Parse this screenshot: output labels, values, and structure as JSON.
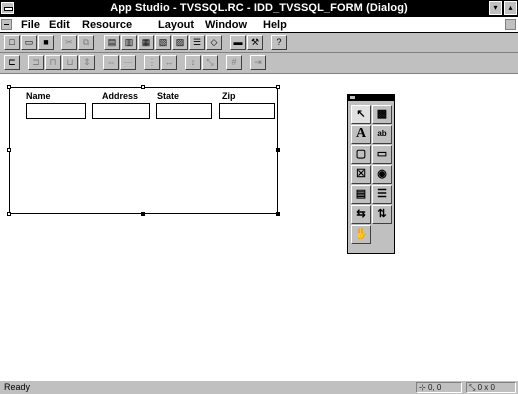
{
  "window": {
    "title": "App Studio - TVSSQL.RC - IDD_TVSSQL_FORM (Dialog)",
    "minimize_glyph": "▾",
    "maximize_glyph": "▴"
  },
  "menu": {
    "items": [
      "File",
      "Edit",
      "Resource",
      "Layout",
      "Window",
      "Help"
    ]
  },
  "toolbar1": {
    "buttons": [
      {
        "name": "new-icon",
        "glyph": "□"
      },
      {
        "name": "open-icon",
        "glyph": "▭"
      },
      {
        "name": "save-icon",
        "glyph": "■"
      },
      {
        "name": "cut-icon",
        "glyph": "✂"
      },
      {
        "name": "copy-icon",
        "glyph": "⧉"
      },
      {
        "name": "new-dialog-icon",
        "glyph": "▤"
      },
      {
        "name": "new-menu-icon",
        "glyph": "▥"
      },
      {
        "name": "new-cursor-icon",
        "glyph": "▦"
      },
      {
        "name": "new-icon-resource-icon",
        "glyph": "▧"
      },
      {
        "name": "new-bitmap-icon",
        "glyph": "▨"
      },
      {
        "name": "new-string-table-icon",
        "glyph": "☰"
      },
      {
        "name": "new-accelerator-icon",
        "glyph": "◇"
      },
      {
        "name": "test-icon",
        "glyph": "▬"
      },
      {
        "name": "class-wizard-icon",
        "glyph": "⚒"
      },
      {
        "name": "help-icon",
        "glyph": "?"
      }
    ]
  },
  "toolbar2": {
    "buttons": [
      {
        "name": "align-left-icon",
        "glyph": "⊏"
      },
      {
        "name": "align-right-icon",
        "glyph": "⊐"
      },
      {
        "name": "align-top-icon",
        "glyph": "⊓"
      },
      {
        "name": "align-bottom-icon",
        "glyph": "⊔"
      },
      {
        "name": "center-vertical-icon",
        "glyph": "⇕"
      },
      {
        "name": "center-horizontal-icon",
        "glyph": "⇔"
      },
      {
        "name": "space-across-icon",
        "glyph": "⋯"
      },
      {
        "name": "space-down-icon",
        "glyph": "⋮"
      },
      {
        "name": "make-same-width-icon",
        "glyph": "↔"
      },
      {
        "name": "make-same-height-icon",
        "glyph": "↕"
      },
      {
        "name": "make-same-size-icon",
        "glyph": "⤡"
      },
      {
        "name": "grid-icon",
        "glyph": "#"
      },
      {
        "name": "tab-order-icon",
        "glyph": "⇥"
      }
    ]
  },
  "dialog": {
    "labels": [
      "Name",
      "Address",
      "State",
      "Zip"
    ],
    "fields": [
      "",
      "",
      "",
      ""
    ]
  },
  "palette": {
    "tools": [
      {
        "name": "pointer-icon",
        "glyph": "↖"
      },
      {
        "name": "picture-icon",
        "glyph": "▩"
      },
      {
        "name": "static-text-icon",
        "glyph": "A"
      },
      {
        "name": "edit-box-icon",
        "glyph": "ab"
      },
      {
        "name": "group-box-icon",
        "glyph": "▢"
      },
      {
        "name": "push-button-icon",
        "glyph": "▭"
      },
      {
        "name": "check-box-icon",
        "glyph": "☒"
      },
      {
        "name": "radio-button-icon",
        "glyph": "◉"
      },
      {
        "name": "combo-box-icon",
        "glyph": "▤"
      },
      {
        "name": "list-box-icon",
        "glyph": "☰"
      },
      {
        "name": "horizontal-scrollbar-icon",
        "glyph": "⇆"
      },
      {
        "name": "vertical-scrollbar-icon",
        "glyph": "⇅"
      },
      {
        "name": "custom-control-icon",
        "glyph": "✋"
      }
    ]
  },
  "status": {
    "message": "Ready",
    "position": "0, 0",
    "size": "0 x 0"
  }
}
